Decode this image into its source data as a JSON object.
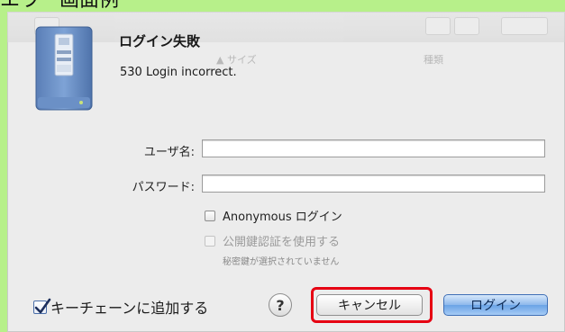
{
  "caption": "エラー画面例",
  "dialog": {
    "title": "ログイン失敗",
    "message": "530 Login incorrect.",
    "icon": "network-drive-icon",
    "ghost": {
      "column_size": "▲ サイズ",
      "column_kind": "種類"
    }
  },
  "form": {
    "username_label": "ユーザ名:",
    "username_value": "",
    "password_label": "パスワード:",
    "password_value": ""
  },
  "options": {
    "anonymous_label": "Anonymous ログイン",
    "anonymous_checked": false,
    "public_key_label": "公開鍵認証を使用する",
    "public_key_checked": false,
    "public_key_enabled": false,
    "public_key_note": "秘密鍵が選択されていません",
    "keychain_label": "キーチェーンに追加する",
    "keychain_checked": true
  },
  "buttons": {
    "help_label": "?",
    "cancel_label": "キャンセル",
    "login_label": "ログイン"
  },
  "colors": {
    "page_background": "#b7f08a",
    "highlight": "#e60012",
    "default_button": "#6aa3e6"
  }
}
